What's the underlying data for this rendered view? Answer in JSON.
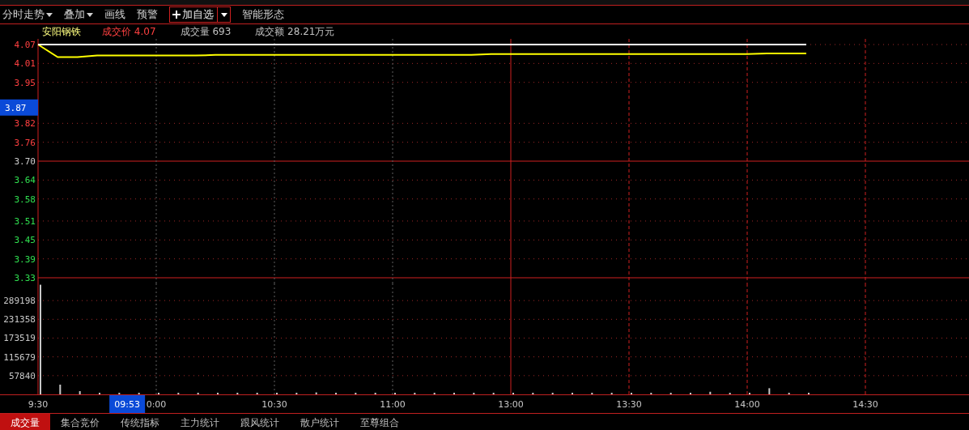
{
  "toolbar": {
    "items": [
      {
        "label": "分时走势",
        "kind": "menu"
      },
      {
        "label": "叠加",
        "kind": "menu"
      },
      {
        "label": "画线",
        "kind": "plain"
      },
      {
        "label": "预警",
        "kind": "plain"
      },
      {
        "label": "加自选",
        "kind": "add"
      },
      {
        "label": "智能形态",
        "kind": "plain"
      }
    ]
  },
  "quote": {
    "name": "安阳钢铁",
    "fields": [
      {
        "label": "成交价",
        "value": "4.07",
        "kind": "price"
      },
      {
        "label": "成交量",
        "value": "693",
        "kind": "plain"
      },
      {
        "label": "成交额",
        "value": "28.21万元",
        "kind": "plain"
      }
    ]
  },
  "price_chart": {
    "chart_data": {
      "type": "line",
      "grid": true,
      "ylim": [
        3.33,
        4.07
      ],
      "yticks": [
        {
          "value": 4.07,
          "label": "4.07"
        },
        {
          "value": 4.01,
          "label": "4.01"
        },
        {
          "value": 3.95,
          "label": "3.95"
        },
        {
          "value": 3.82,
          "label": "3.82"
        },
        {
          "value": 3.76,
          "label": "3.76"
        },
        {
          "value": 3.7,
          "label": "3.70"
        },
        {
          "value": 3.64,
          "label": "3.64"
        },
        {
          "value": 3.58,
          "label": "3.58"
        },
        {
          "value": 3.51,
          "label": "3.51"
        },
        {
          "value": 3.45,
          "label": "3.45"
        },
        {
          "value": 3.39,
          "label": "3.39"
        },
        {
          "value": 3.33,
          "label": "3.33"
        }
      ],
      "categories": [
        null,
        null,
        null,
        null,
        null,
        null,
        null,
        null,
        null,
        null,
        null,
        null,
        null,
        null,
        null,
        null,
        null,
        null,
        null,
        null,
        null,
        null,
        null,
        null,
        null,
        null,
        null,
        null,
        null,
        null,
        null,
        null,
        null,
        null,
        null,
        null,
        null,
        null,
        null,
        null,
        null,
        null,
        null,
        null,
        null,
        null,
        null,
        null
      ],
      "series": [
        {
          "color": "#ffff00",
          "values": [
            4.07,
            4.03,
            4.03,
            4.035,
            4.035,
            4.035,
            4.035,
            4.035,
            4.035,
            4.037,
            4.037,
            4.037,
            4.037,
            4.037,
            4.037,
            4.037,
            4.037,
            4.037,
            4.037,
            4.037,
            4.037,
            4.037,
            4.037,
            4.04,
            4.04,
            4.04,
            4.04,
            4.04,
            4.04,
            4.04,
            4.04,
            4.04,
            4.04,
            4.04,
            4.04,
            4.04,
            4.04,
            4.042,
            4.042,
            4.042,
            null,
            null,
            null,
            null,
            null,
            null,
            null,
            null
          ]
        },
        {
          "color": "#ffffff",
          "values": [
            4.07,
            4.07,
            4.07,
            4.07,
            4.07,
            4.07,
            4.07,
            4.07,
            4.07,
            4.07,
            4.07,
            4.07,
            4.07,
            4.07,
            4.07,
            4.07,
            4.07,
            4.07,
            4.07,
            4.07,
            4.07,
            4.07,
            4.07,
            4.07,
            4.07,
            4.07,
            4.07,
            4.07,
            4.07,
            4.07,
            4.07,
            4.07,
            4.07,
            4.07,
            4.07,
            4.07,
            4.07,
            4.07,
            4.07,
            4.07,
            null,
            null,
            null,
            null,
            null,
            null,
            null,
            null
          ]
        }
      ]
    }
  },
  "crosshair": {
    "price": "3.87",
    "time": "09:53"
  },
  "volume_chart": {
    "chart_data": {
      "type": "bar",
      "grid": true,
      "ylim": [
        0,
        342000
      ],
      "yticks": [
        {
          "value": 289198,
          "label": "289198"
        },
        {
          "value": 231358,
          "label": "231358"
        },
        {
          "value": 173519,
          "label": "173519"
        },
        {
          "value": 115679,
          "label": "115679"
        },
        {
          "value": 57840,
          "label": "57840"
        }
      ],
      "categories": [
        "9:30",
        null,
        null,
        null,
        null,
        null,
        "0:00",
        null,
        null,
        null,
        null,
        null,
        "10:30",
        null,
        null,
        null,
        null,
        null,
        "11:00",
        null,
        null,
        null,
        null,
        null,
        "13:00",
        null,
        null,
        null,
        null,
        null,
        "13:30",
        null,
        null,
        null,
        null,
        null,
        "14:00",
        null,
        null,
        null,
        null,
        null,
        "14:30",
        null,
        null,
        null,
        null,
        null
      ],
      "series": [
        {
          "color": "#c8c8c8",
          "values": [
            338000,
            30000,
            10000,
            5000,
            5000,
            5000,
            5000,
            5000,
            5000,
            5000,
            5000,
            5000,
            5000,
            5000,
            6000,
            5000,
            5000,
            5000,
            5000,
            5000,
            5000,
            5000,
            5000,
            5000,
            5000,
            5000,
            5000,
            5000,
            5000,
            5000,
            5000,
            5000,
            5000,
            5000,
            8000,
            5000,
            5000,
            19000,
            5000,
            5000,
            null,
            null,
            null,
            null,
            null,
            null,
            null,
            null
          ]
        }
      ]
    }
  },
  "bottom_tabs": [
    {
      "label": "成交量",
      "selected": true
    },
    {
      "label": "集合竞价",
      "selected": false
    },
    {
      "label": "传统指标",
      "selected": false
    },
    {
      "label": "主力统计",
      "selected": false
    },
    {
      "label": "跟风统计",
      "selected": false
    },
    {
      "label": "散户统计",
      "selected": false
    },
    {
      "label": "至尊组合",
      "selected": false
    }
  ]
}
